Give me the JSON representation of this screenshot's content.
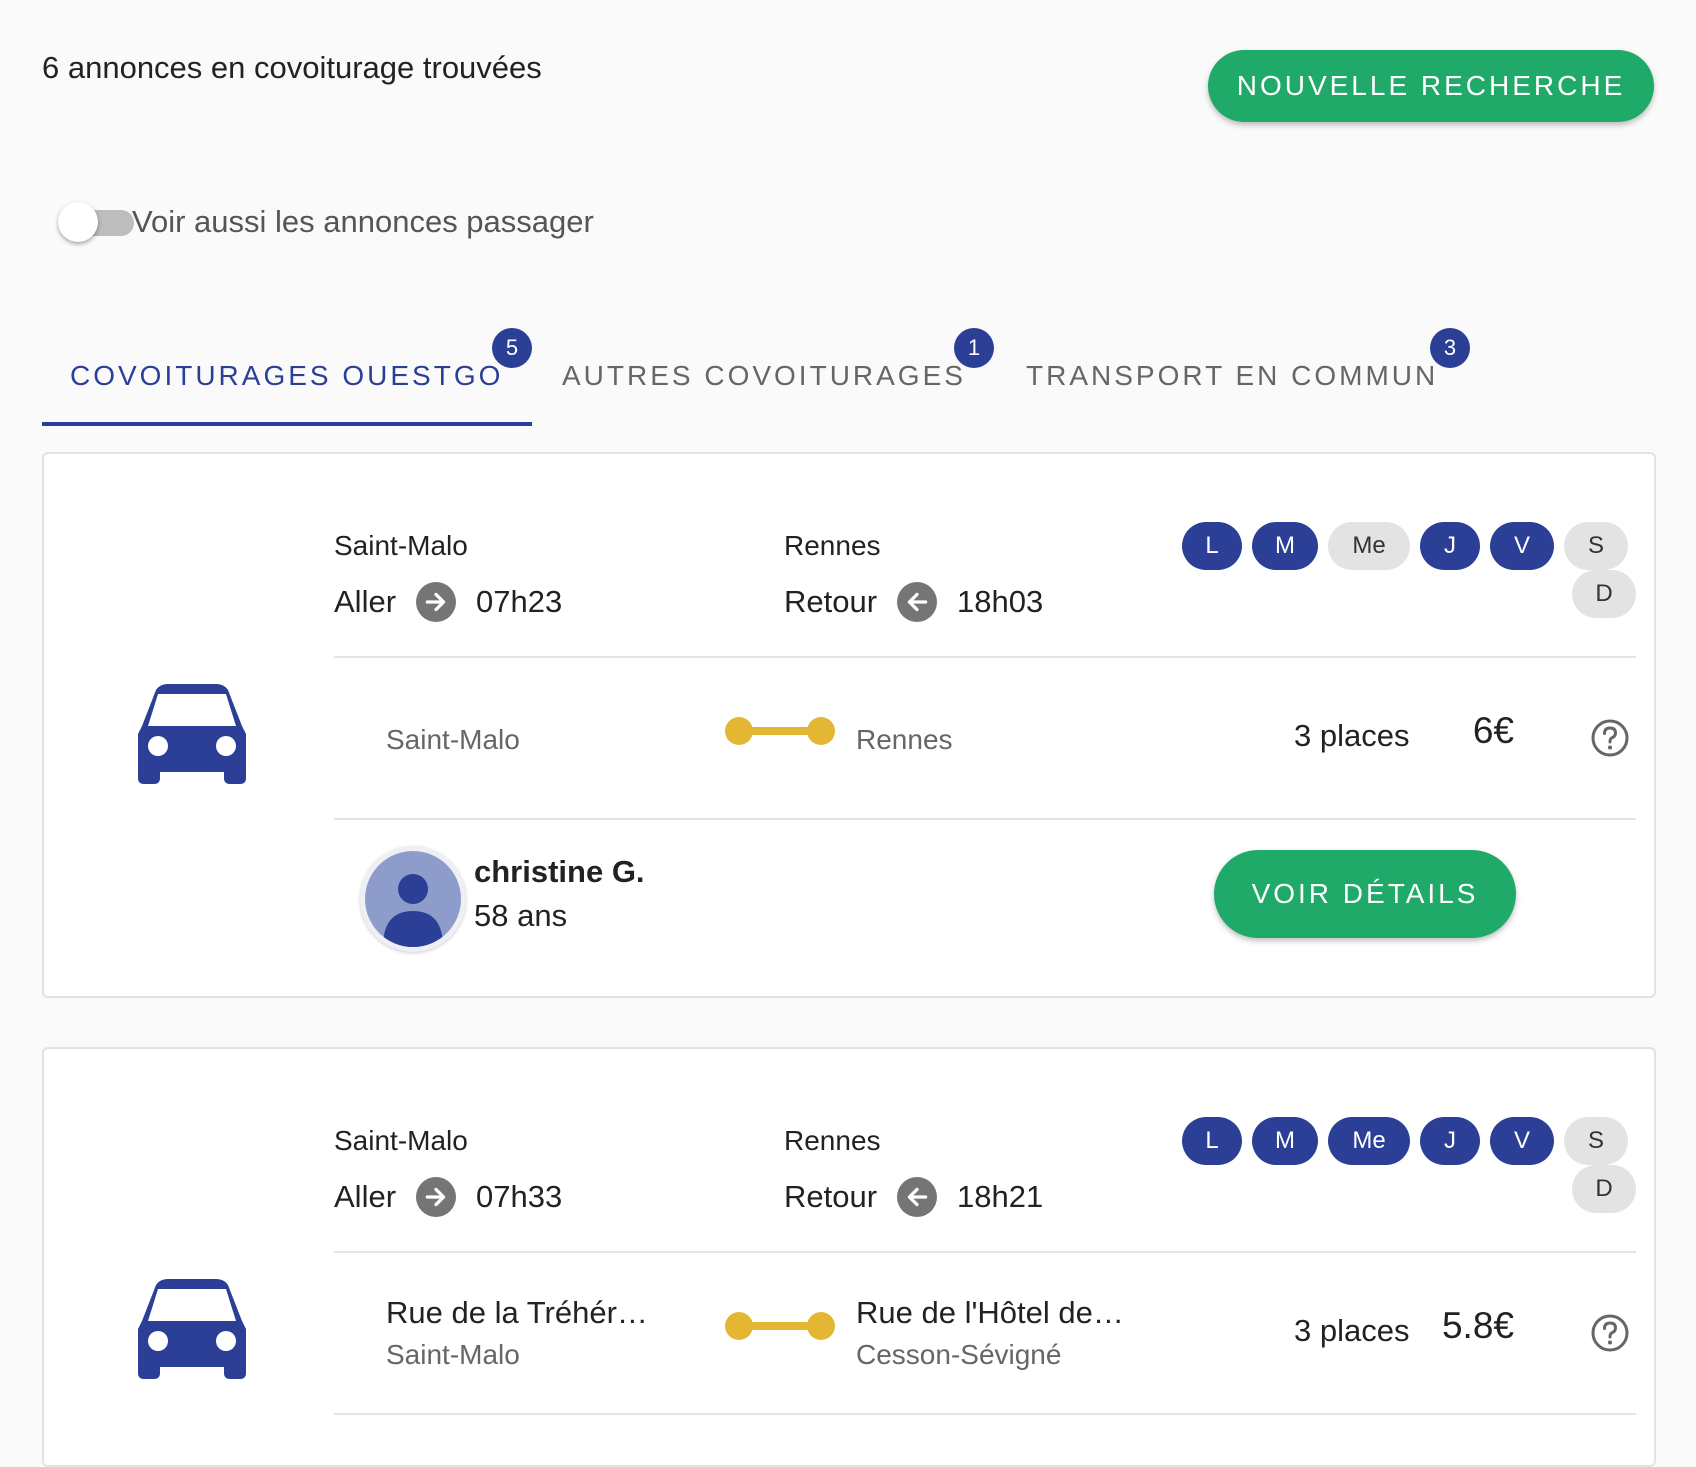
{
  "header": {
    "results_count": "6 annonces en covoiturage trouvées",
    "new_search_label": "NOUVELLE RECHERCHE"
  },
  "toggle": {
    "label": "Voir aussi les annonces passager",
    "checked": false
  },
  "tabs": [
    {
      "label": "COVOITURAGES OUESTGO",
      "badge": "5",
      "active": true
    },
    {
      "label": "AUTRES COVOITURAGES",
      "badge": "1",
      "active": false
    },
    {
      "label": "TRANSPORT EN COMMUN",
      "badge": "3",
      "active": false
    }
  ],
  "colors": {
    "primary": "#2b3f96",
    "accent_green": "#1faa6a",
    "route_yellow": "#e3b733"
  },
  "icons": [
    "car-icon",
    "arrow-right-icon",
    "arrow-left-icon",
    "help-circle-icon",
    "person-icon"
  ],
  "listings": [
    {
      "origin_city": "Saint-Malo",
      "destination_city": "Rennes",
      "outbound_label": "Aller",
      "outbound_time": "07h23",
      "return_label": "Retour",
      "return_time": "18h03",
      "days": [
        {
          "label": "L",
          "active": true
        },
        {
          "label": "M",
          "active": true
        },
        {
          "label": "Me",
          "active": false
        },
        {
          "label": "J",
          "active": true
        },
        {
          "label": "V",
          "active": true
        },
        {
          "label": "S",
          "active": false
        },
        {
          "label": "D",
          "active": false
        }
      ],
      "from_address": "",
      "from_city": "Saint-Malo",
      "to_address": "",
      "to_city": "Rennes",
      "seats": "3 places",
      "price": "6€",
      "driver": {
        "name": "christine G.",
        "age": "58 ans"
      },
      "details_label": "VOIR DÉTAILS"
    },
    {
      "origin_city": "Saint-Malo",
      "destination_city": "Rennes",
      "outbound_label": "Aller",
      "outbound_time": "07h33",
      "return_label": "Retour",
      "return_time": "18h21",
      "days": [
        {
          "label": "L",
          "active": true
        },
        {
          "label": "M",
          "active": true
        },
        {
          "label": "Me",
          "active": true
        },
        {
          "label": "J",
          "active": true
        },
        {
          "label": "V",
          "active": true
        },
        {
          "label": "S",
          "active": false
        },
        {
          "label": "D",
          "active": false
        }
      ],
      "from_address": "Rue de la Tréhér…",
      "from_city": "Saint-Malo",
      "to_address": "Rue de l'Hôtel de…",
      "to_city": "Cesson-Sévigné",
      "seats": "3 places",
      "price": "5.8€"
    }
  ]
}
